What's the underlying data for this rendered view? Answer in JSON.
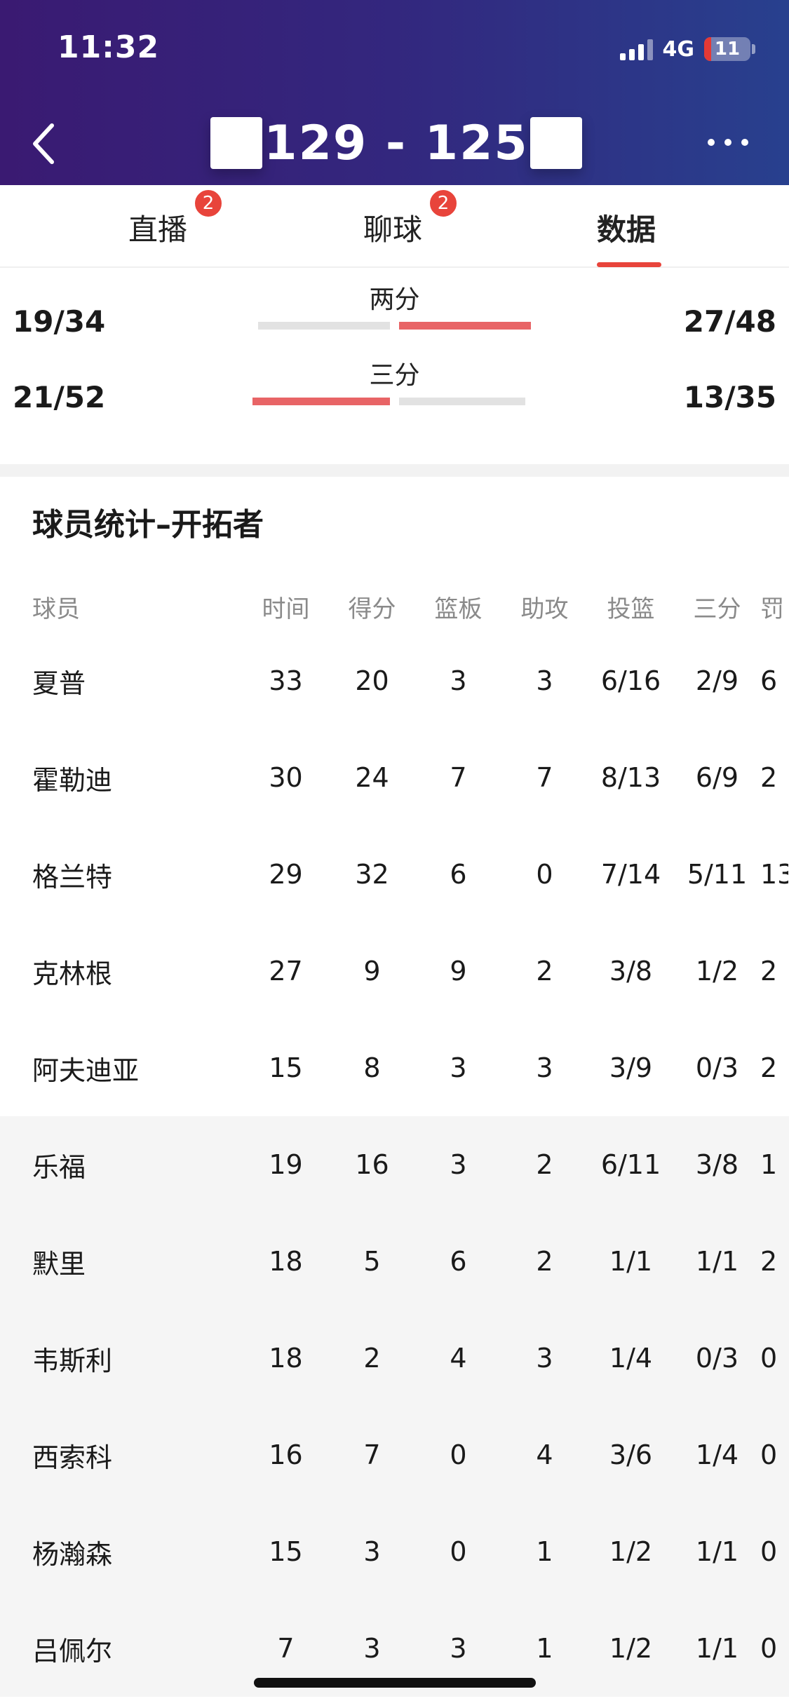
{
  "status_bar": {
    "time": "11:32",
    "network": "4G",
    "battery": "11"
  },
  "header": {
    "score": "129  -  125"
  },
  "tabs": [
    {
      "label": "直播",
      "badge": "2"
    },
    {
      "label": "聊球",
      "badge": "2"
    },
    {
      "label": "数据",
      "badge": ""
    }
  ],
  "shooting": {
    "two_point": {
      "label": "两分",
      "left": "19/34",
      "right": "27/48"
    },
    "three_point": {
      "label": "三分",
      "left": "21/52",
      "right": "13/35"
    }
  },
  "colors": {
    "accent": "#e8443b",
    "header_start": "#3a1a72",
    "header_end": "#28408e"
  },
  "section_title": "球员统计–开拓者",
  "table": {
    "headers": [
      "球员",
      "时间",
      "得分",
      "篮板",
      "助攻",
      "投篮",
      "三分",
      "罚"
    ],
    "rows": [
      [
        "夏普",
        "33",
        "20",
        "3",
        "3",
        "6/16",
        "2/9",
        "6"
      ],
      [
        "霍勒迪",
        "30",
        "24",
        "7",
        "7",
        "8/13",
        "6/9",
        "2"
      ],
      [
        "格兰特",
        "29",
        "32",
        "6",
        "0",
        "7/14",
        "5/11",
        "13"
      ],
      [
        "克林根",
        "27",
        "9",
        "9",
        "2",
        "3/8",
        "1/2",
        "2"
      ],
      [
        "阿夫迪亚",
        "15",
        "8",
        "3",
        "3",
        "3/9",
        "0/3",
        "2"
      ],
      [
        "乐福",
        "19",
        "16",
        "3",
        "2",
        "6/11",
        "3/8",
        "1"
      ],
      [
        "默里",
        "18",
        "5",
        "6",
        "2",
        "1/1",
        "1/1",
        "2"
      ],
      [
        "韦斯利",
        "18",
        "2",
        "4",
        "3",
        "1/4",
        "0/3",
        "0"
      ],
      [
        "西索科",
        "16",
        "7",
        "0",
        "4",
        "3/6",
        "1/4",
        "0"
      ],
      [
        "杨瀚森",
        "15",
        "3",
        "0",
        "1",
        "1/2",
        "1/1",
        "0"
      ],
      [
        "吕佩尔",
        "7",
        "3",
        "3",
        "1",
        "1/2",
        "1/1",
        "0"
      ]
    ]
  }
}
